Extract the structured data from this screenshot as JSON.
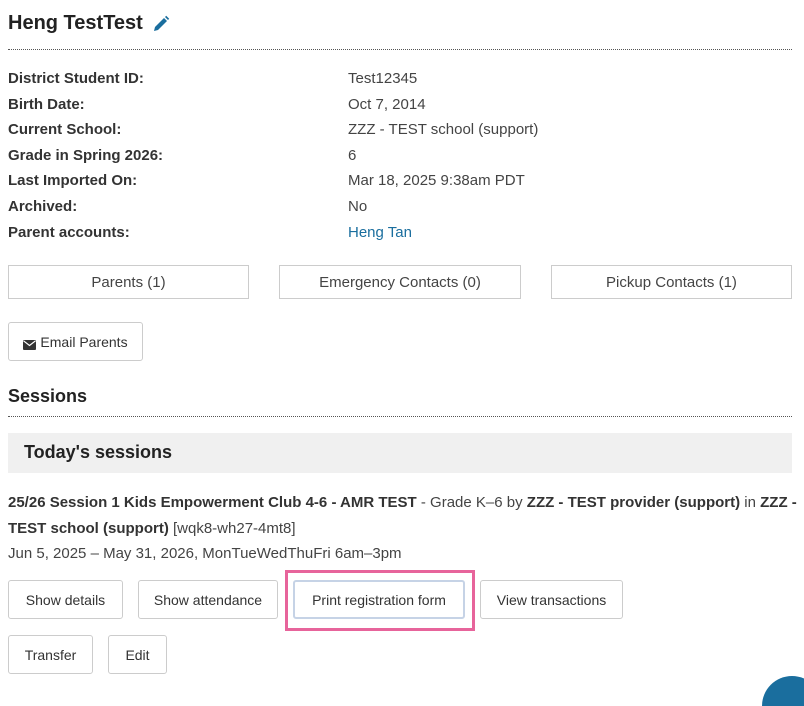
{
  "student": {
    "name": "Heng TestTest",
    "fields": [
      {
        "label": "District Student ID:",
        "value": "Test12345"
      },
      {
        "label": "Birth Date:",
        "value": "Oct 7, 2014"
      },
      {
        "label": "Current School:",
        "value": "ZZZ - TEST school (support)"
      },
      {
        "label": "Grade in Spring 2026:",
        "value": "6"
      },
      {
        "label": "Last Imported On:",
        "value": "Mar 18, 2025 9:38am PDT"
      },
      {
        "label": "Archived:",
        "value": "No"
      },
      {
        "label": "Parent accounts:",
        "value": "Heng Tan"
      }
    ]
  },
  "contact_tabs": {
    "parents": "Parents (1)",
    "emergency": "Emergency Contacts (0)",
    "pickup": "Pickup Contacts (1)"
  },
  "email_parents_label": "Email Parents",
  "sessions": {
    "heading": "Sessions",
    "today_heading": "Today's sessions",
    "session": {
      "name": "25/26 Session 1 Kids Empowerment Club 4-6 - AMR TEST",
      "grade_text": " - Grade K–6 by ",
      "provider": "ZZZ - TEST provider (support)",
      "in_text": " in ",
      "school": "ZZZ - TEST school (support)",
      "code": " [wqk8-wh27-4mt8]",
      "schedule": "Jun 5, 2025 – May 31, 2026, MonTueWedThuFri 6am–3pm"
    },
    "actions": {
      "show_details": "Show details",
      "show_attendance": "Show attendance",
      "print_registration": "Print registration form",
      "view_transactions": "View transactions",
      "transfer": "Transfer",
      "edit": "Edit"
    }
  },
  "colors": {
    "link": "#1a6e9e",
    "highlight": "#e7649b"
  }
}
